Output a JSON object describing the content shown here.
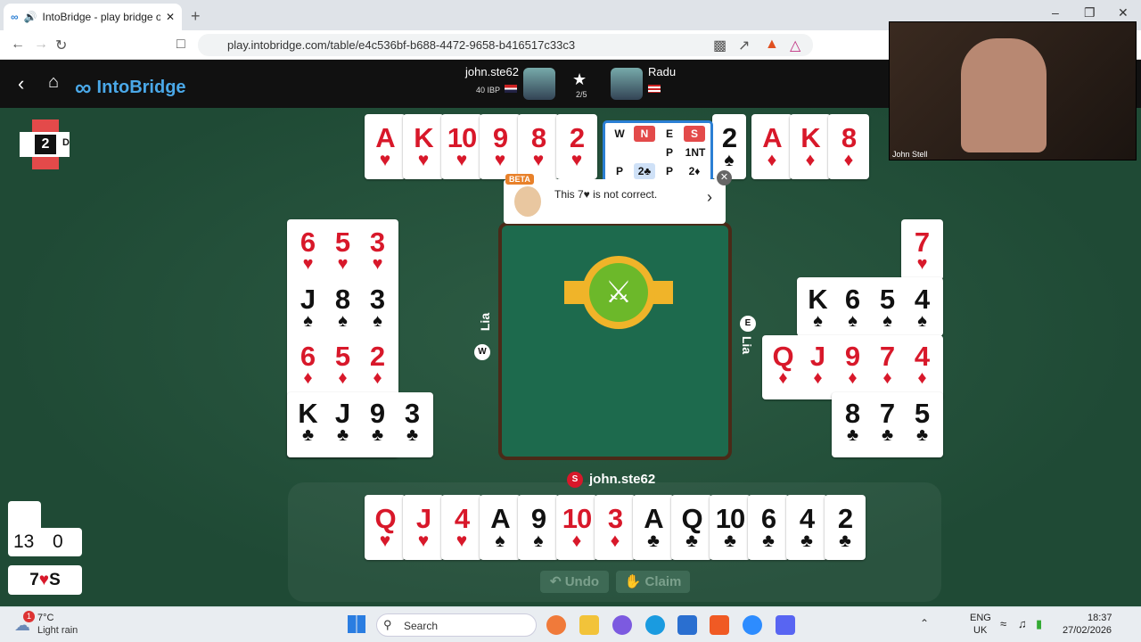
{
  "browser": {
    "tab_title": "IntoBridge - play bridge onlin",
    "url": "play.intobridge.com/table/e4c536bf-b688-4472-9658-b416517c33c3",
    "new_tab": "+",
    "minimize": "–",
    "maximize": "❐",
    "close": "✕"
  },
  "app": {
    "logo": "IntoBridge",
    "back": "‹",
    "home": "⌂"
  },
  "players": {
    "south_name": "john.ste62",
    "south_sub": "40 IBP",
    "north_name": "Radu",
    "board_count": "2/5",
    "west_name": "Lia",
    "east_name": "Lia",
    "south_seat": "S",
    "west_seat": "W",
    "east_seat": "E"
  },
  "board": {
    "number": "2",
    "dealer": "D"
  },
  "north_cards": [
    {
      "rank": "A",
      "suit": "♥",
      "color": "red"
    },
    {
      "rank": "K",
      "suit": "♥",
      "color": "red"
    },
    {
      "rank": "10",
      "suit": "♥",
      "color": "red"
    },
    {
      "rank": "9",
      "suit": "♥",
      "color": "red"
    },
    {
      "rank": "8",
      "suit": "♥",
      "color": "red"
    },
    {
      "rank": "2",
      "suit": "♥",
      "color": "red"
    },
    {
      "rank": "2",
      "suit": "♠",
      "color": "blk"
    },
    {
      "rank": "A",
      "suit": "♦",
      "color": "red"
    },
    {
      "rank": "K",
      "suit": "♦",
      "color": "red"
    },
    {
      "rank": "8",
      "suit": "♦",
      "color": "red"
    }
  ],
  "south_cards": [
    {
      "rank": "Q",
      "suit": "♥",
      "color": "red"
    },
    {
      "rank": "J",
      "suit": "♥",
      "color": "red"
    },
    {
      "rank": "4",
      "suit": "♥",
      "color": "red"
    },
    {
      "rank": "A",
      "suit": "♠",
      "color": "blk"
    },
    {
      "rank": "9",
      "suit": "♠",
      "color": "blk"
    },
    {
      "rank": "10",
      "suit": "♦",
      "color": "red"
    },
    {
      "rank": "3",
      "suit": "♦",
      "color": "red"
    },
    {
      "rank": "A",
      "suit": "♣",
      "color": "blk"
    },
    {
      "rank": "Q",
      "suit": "♣",
      "color": "blk"
    },
    {
      "rank": "10",
      "suit": "♣",
      "color": "blk"
    },
    {
      "rank": "6",
      "suit": "♣",
      "color": "blk"
    },
    {
      "rank": "4",
      "suit": "♣",
      "color": "blk"
    },
    {
      "rank": "2",
      "suit": "♣",
      "color": "blk"
    }
  ],
  "west_rows": [
    [
      {
        "rank": "6",
        "suit": "♥",
        "color": "red"
      },
      {
        "rank": "5",
        "suit": "♥",
        "color": "red"
      },
      {
        "rank": "3",
        "suit": "♥",
        "color": "red"
      }
    ],
    [
      {
        "rank": "J",
        "suit": "♠",
        "color": "blk"
      },
      {
        "rank": "8",
        "suit": "♠",
        "color": "blk"
      },
      {
        "rank": "3",
        "suit": "♠",
        "color": "blk"
      }
    ],
    [
      {
        "rank": "6",
        "suit": "♦",
        "color": "red"
      },
      {
        "rank": "5",
        "suit": "♦",
        "color": "red"
      },
      {
        "rank": "2",
        "suit": "♦",
        "color": "red"
      }
    ],
    [
      {
        "rank": "K",
        "suit": "♣",
        "color": "blk"
      },
      {
        "rank": "J",
        "suit": "♣",
        "color": "blk"
      },
      {
        "rank": "9",
        "suit": "♣",
        "color": "blk"
      },
      {
        "rank": "3",
        "suit": "♣",
        "color": "blk"
      }
    ]
  ],
  "east_rows": [
    [
      {
        "rank": "7",
        "suit": "♥",
        "color": "red"
      }
    ],
    [
      {
        "rank": "K",
        "suit": "♠",
        "color": "blk"
      },
      {
        "rank": "6",
        "suit": "♠",
        "color": "blk"
      },
      {
        "rank": "5",
        "suit": "♠",
        "color": "blk"
      },
      {
        "rank": "4",
        "suit": "♠",
        "color": "blk"
      }
    ],
    [
      {
        "rank": "Q",
        "suit": "♦",
        "color": "red"
      },
      {
        "rank": "J",
        "suit": "♦",
        "color": "red"
      },
      {
        "rank": "9",
        "suit": "♦",
        "color": "red"
      },
      {
        "rank": "7",
        "suit": "♦",
        "color": "red"
      },
      {
        "rank": "4",
        "suit": "♦",
        "color": "red"
      }
    ],
    [
      {
        "rank": "8",
        "suit": "♣",
        "color": "blk"
      },
      {
        "rank": "7",
        "suit": "♣",
        "color": "blk"
      },
      {
        "rank": "5",
        "suit": "♣",
        "color": "blk"
      }
    ]
  ],
  "bidding": {
    "headers": [
      "W",
      "N",
      "E",
      "S"
    ],
    "row1": [
      "",
      "",
      "P",
      "1NT"
    ],
    "row2": [
      "P",
      "2♣",
      "P",
      "2♦"
    ]
  },
  "hint": {
    "badge": "BETA",
    "text": "This 7♥ is not correct.",
    "arrow": "›"
  },
  "actions": {
    "undo": "Undo",
    "claim": "Claim"
  },
  "score": {
    "ns": "13",
    "ew": "0",
    "contract_level": "7",
    "contract_suit": "♥",
    "contract_declarer": "S"
  },
  "video": {
    "name": "John Stell"
  },
  "taskbar": {
    "temp": "7°C",
    "weather": "Light rain",
    "search": "Search",
    "lang1": "ENG",
    "lang2": "UK",
    "time": "18:37",
    "date": "27/02/2026",
    "badge": "1"
  },
  "colors": {
    "felt": "#1f4a35",
    "trick": "#1d6a4d",
    "red": "#d8182a",
    "accent": "#2b7fd4"
  }
}
